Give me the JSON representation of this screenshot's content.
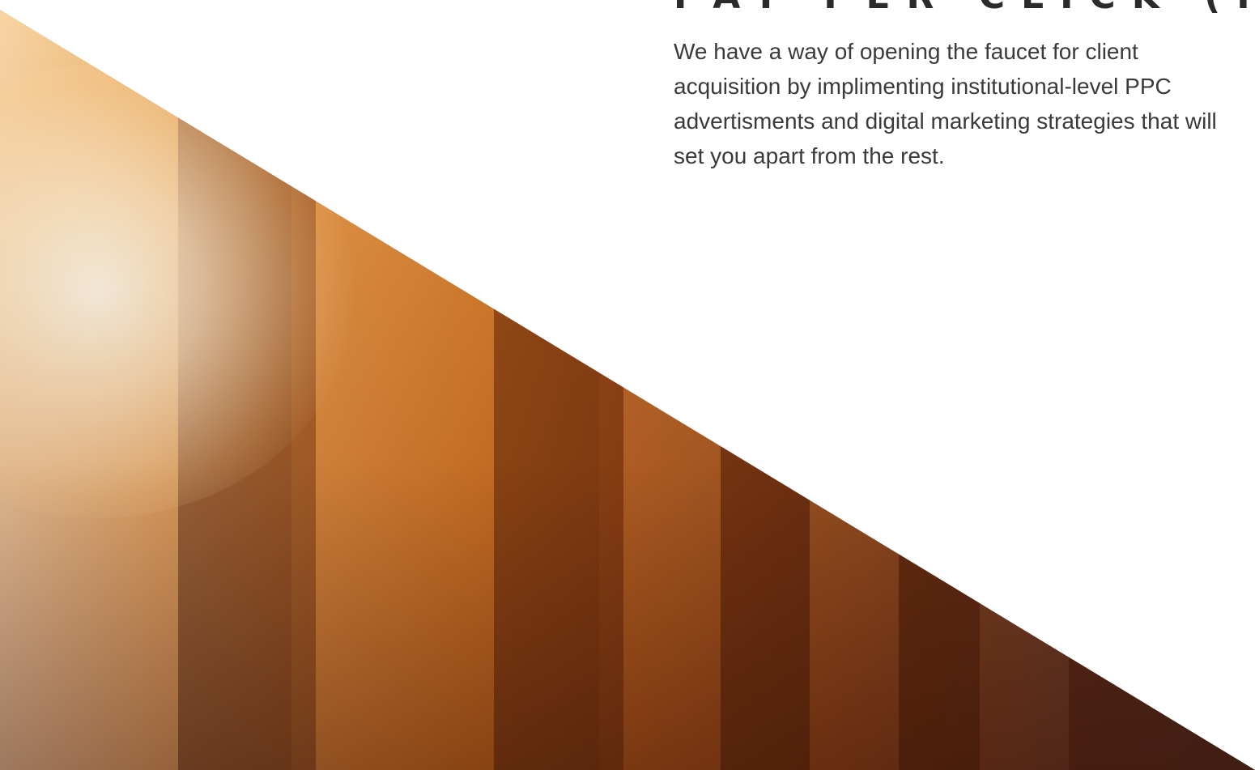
{
  "section": {
    "heading": "PAY PER CLICK (PPC)",
    "body": "We have a way of opening the faucet for client acquisition by implimenting institutional-level PPC advertisments and digital marketing strategies that will set you apart from the rest."
  },
  "colors": {
    "background": "#ffffff",
    "heading_text": "#2b2b2b",
    "body_text": "#3a3a3a",
    "accent_orange": "#d9863d"
  }
}
